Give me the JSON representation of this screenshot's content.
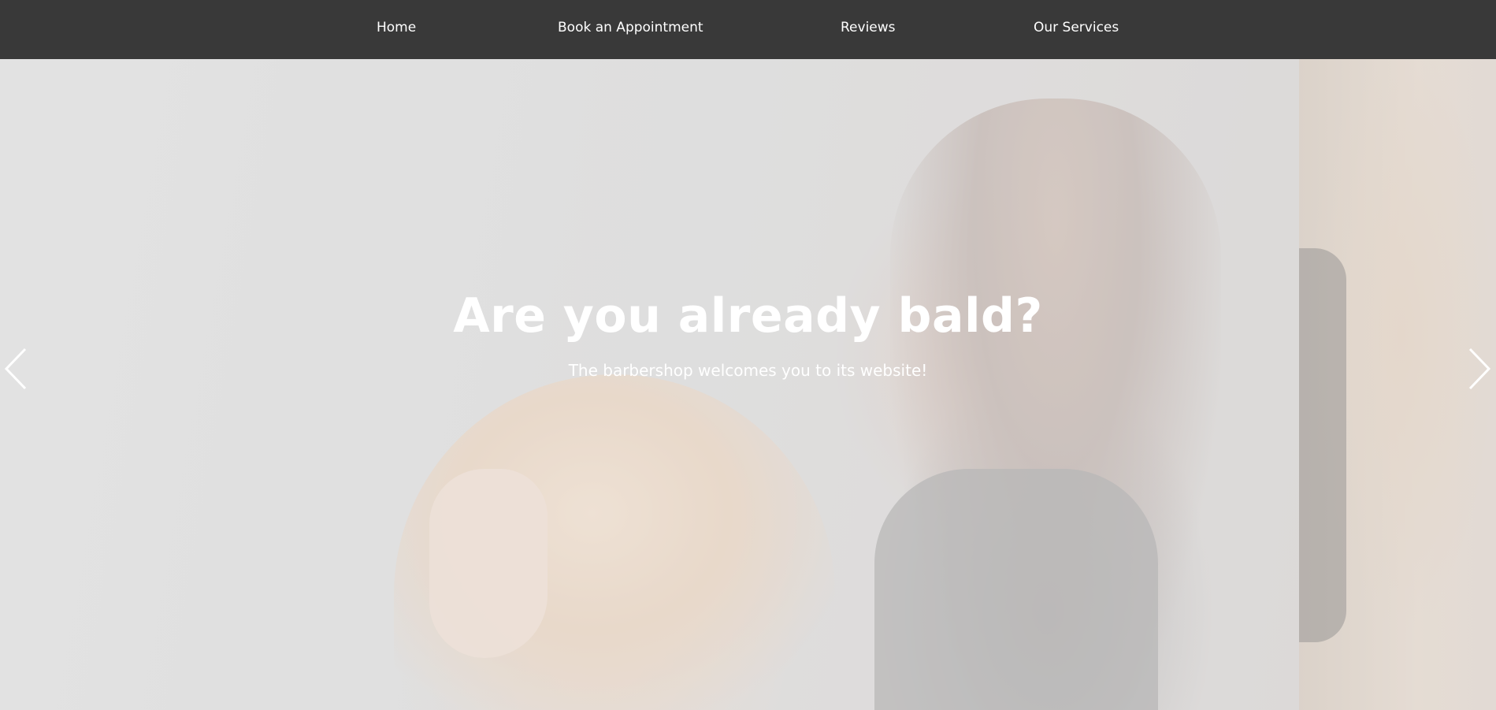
{
  "nav": {
    "items": [
      {
        "label": "Home"
      },
      {
        "label": "Book an Appointment"
      },
      {
        "label": "Reviews"
      },
      {
        "label": "Our Services"
      }
    ]
  },
  "hero": {
    "title": "Are you already bald?",
    "subtitle": "The barbershop welcomes you to its website!"
  },
  "carousel": {
    "prev_icon": "chevron-left-icon",
    "next_icon": "chevron-right-icon"
  },
  "colors": {
    "navbar_bg": "#393939",
    "text": "#ffffff"
  }
}
